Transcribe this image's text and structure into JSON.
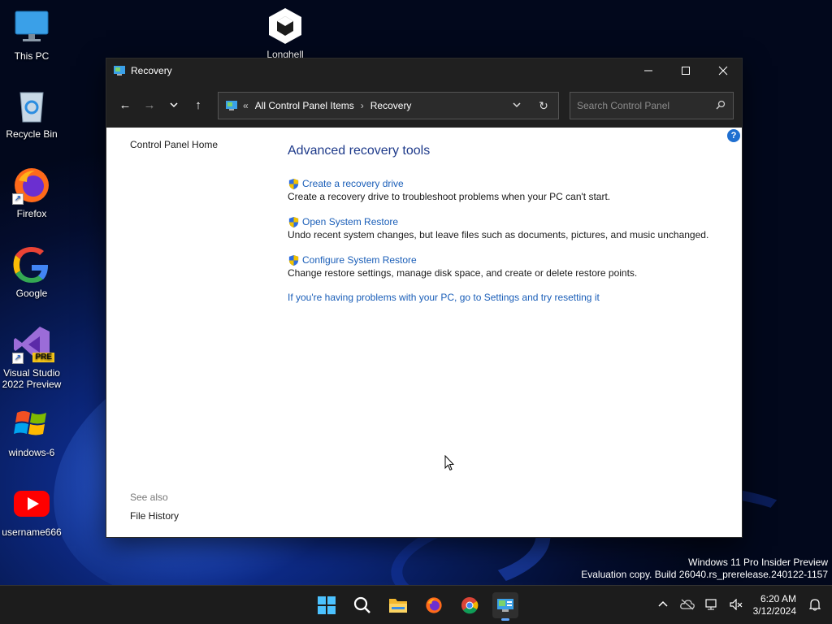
{
  "desktop": {
    "icons": [
      {
        "label": "This PC"
      },
      {
        "label": "Longhell"
      },
      {
        "label": "Recycle Bin"
      },
      {
        "label": "Firefox"
      },
      {
        "label": "Google"
      },
      {
        "label": "Visual Studio 2022 Preview",
        "badge": "PRE"
      },
      {
        "label": "windows-6"
      },
      {
        "label": "username666"
      }
    ]
  },
  "window": {
    "title": "Recovery",
    "address": {
      "overflow": "«",
      "crumbs": [
        "All Control Panel Items",
        "Recovery"
      ]
    },
    "search": {
      "placeholder": "Search Control Panel"
    },
    "left_nav": {
      "home": "Control Panel Home",
      "see_also_heading": "See also",
      "see_also_items": [
        "File History"
      ]
    },
    "help_label": "?",
    "main": {
      "heading": "Advanced recovery tools",
      "tools": [
        {
          "title": "Create a recovery drive",
          "desc": "Create a recovery drive to troubleshoot problems when your PC can't start."
        },
        {
          "title": "Open System Restore",
          "desc": "Undo recent system changes, but leave files such as documents, pictures, and music unchanged."
        },
        {
          "title": "Configure System Restore",
          "desc": "Change restore settings, manage disk space, and create or delete restore points."
        }
      ],
      "reset_link": "If you're having problems with your PC, go to Settings and try resetting it"
    }
  },
  "watermark": {
    "line1": "Windows 11 Pro Insider Preview",
    "line2": "Evaluation copy. Build 26040.rs_prerelease.240122-1157"
  },
  "taskbar": {
    "items": [
      "start-icon",
      "search-icon",
      "file-explorer-icon",
      "firefox-icon",
      "chrome-icon",
      "control-panel-icon"
    ],
    "clock": {
      "time": "6:20 AM",
      "date": "3/12/2024"
    }
  },
  "colors": {
    "link": "#1a5eb8",
    "heading": "#1e3a8a",
    "titlebar": "#202020",
    "accent": "#60a5fa"
  }
}
